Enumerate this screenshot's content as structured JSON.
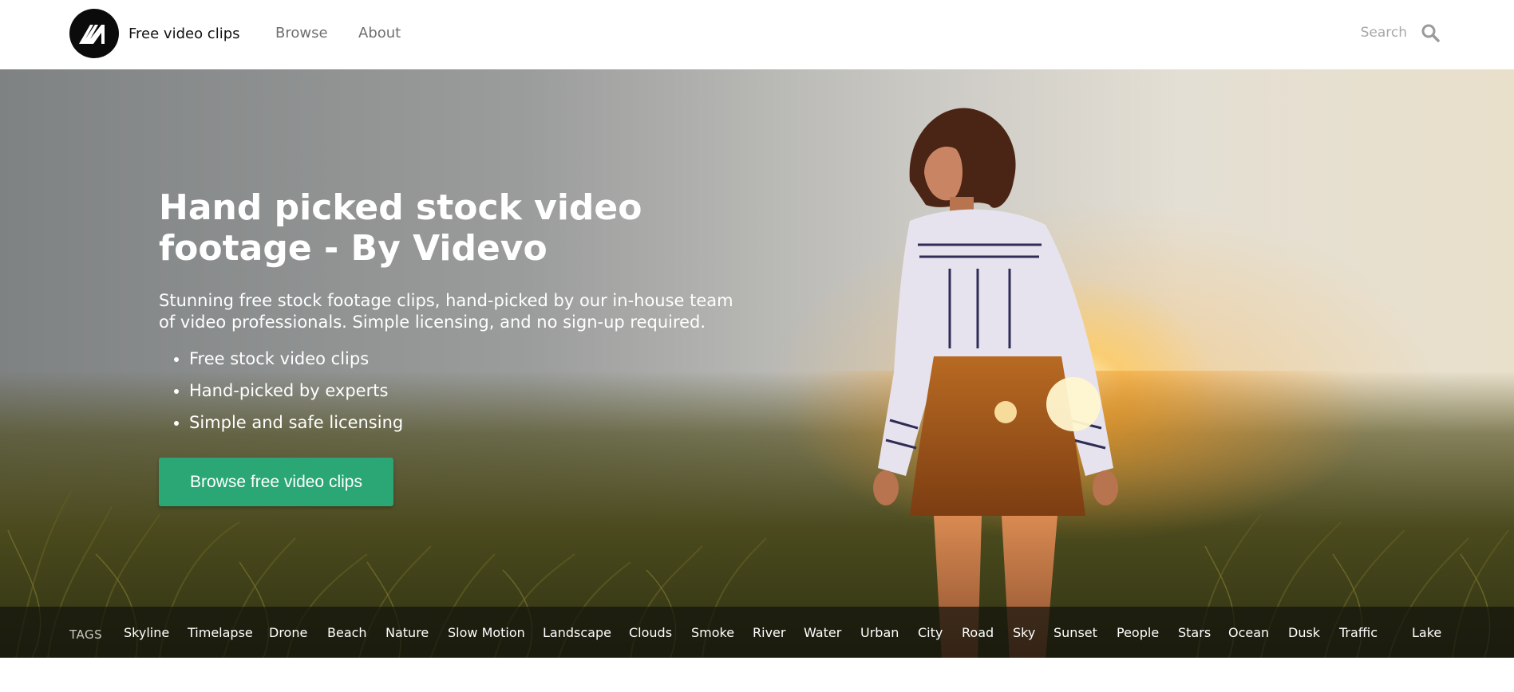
{
  "header": {
    "site_name": "Free video clips",
    "nav": [
      {
        "label": "Browse"
      },
      {
        "label": "About"
      }
    ],
    "search": {
      "placeholder": "Search",
      "value": ""
    }
  },
  "hero": {
    "title": "Hand picked stock video footage - By Videvo",
    "description": "Stunning free stock footage clips, hand-picked by our in-house team of video professionals. Simple licensing, and no sign-up required.",
    "bullets": [
      "Free stock video clips",
      "Hand-picked by experts",
      "Simple and safe licensing"
    ],
    "cta_label": "Browse free video clips"
  },
  "tags": {
    "label": "TAGS",
    "items": [
      "Skyline",
      "Timelapse",
      "Drone",
      "Beach",
      "Nature",
      "Slow Motion",
      "Landscape",
      "Clouds",
      "Smoke",
      "River",
      "Water",
      "Urban",
      "City",
      "Road",
      "Sky",
      "Sunset",
      "People",
      "Stars",
      "Ocean",
      "Dusk",
      "Traffic",
      "Lake"
    ]
  },
  "colors": {
    "accent": "#2aa775",
    "header_bg": "#ffffff",
    "tags_bar_bg": "#1c1c12"
  },
  "icons": {
    "logo": "videvo-logo-icon",
    "search": "search-icon"
  }
}
